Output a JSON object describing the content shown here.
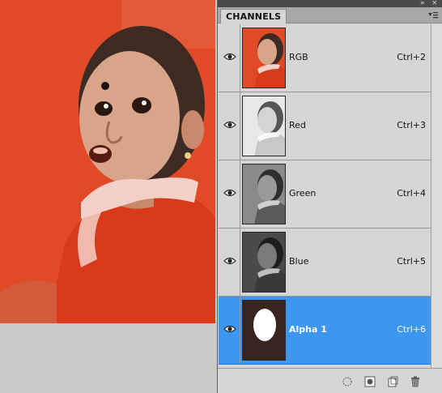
{
  "panel": {
    "tab_label": "CHANNELS"
  },
  "channels": [
    {
      "name": "RGB",
      "shortcut": "Ctrl+2",
      "visible": true,
      "selected": false,
      "thumb": "color"
    },
    {
      "name": "Red",
      "shortcut": "Ctrl+3",
      "visible": true,
      "selected": false,
      "thumb": "red"
    },
    {
      "name": "Green",
      "shortcut": "Ctrl+4",
      "visible": true,
      "selected": false,
      "thumb": "green"
    },
    {
      "name": "Blue",
      "shortcut": "Ctrl+5",
      "visible": true,
      "selected": false,
      "thumb": "blue"
    },
    {
      "name": "Alpha 1",
      "shortcut": "Ctrl+6",
      "visible": true,
      "selected": true,
      "thumb": "alpha"
    }
  ],
  "footer": {
    "buttons": [
      "load-selection-icon",
      "save-selection-icon",
      "new-channel-icon",
      "delete-channel-icon"
    ]
  },
  "colors": {
    "selection": "#3d97f0",
    "image_background": "#e04a26",
    "panel_background": "#d6d6d6"
  }
}
